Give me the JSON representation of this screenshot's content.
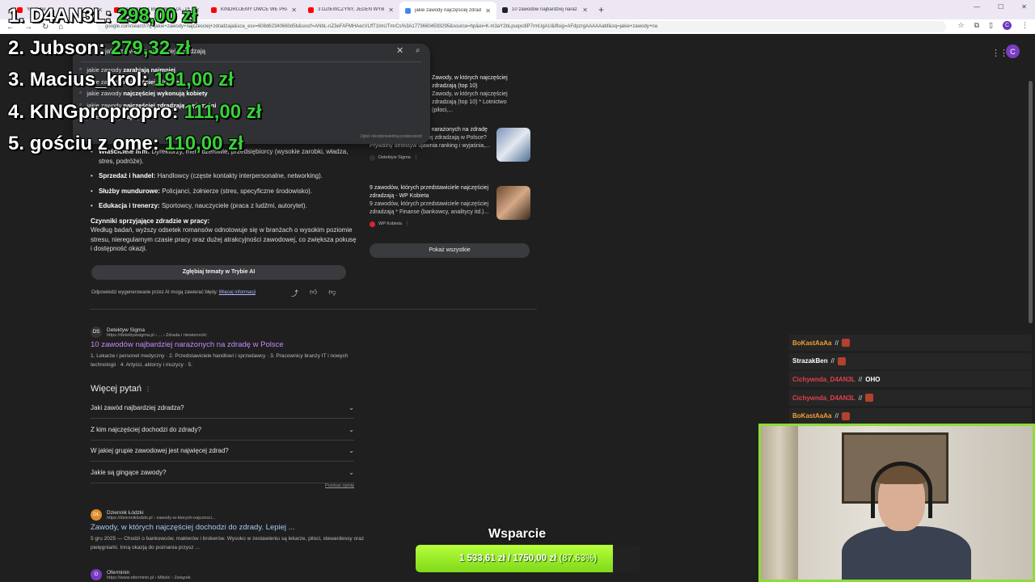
{
  "browser": {
    "tabs": [
      {
        "title": "YouTube",
        "color": "#ff0000"
      },
      {
        "title": "SPOWIEDŹ BRAMKARZA - PEJ",
        "color": "#ff0000"
      },
      {
        "title": "KINDRUJEMY OWCE WE PRAW",
        "color": "#ff0000"
      },
      {
        "title": "3 DZIEWCZYNY, JEDEN WYBÓ",
        "color": "#ff0000"
      },
      {
        "title": "jakie zawody najczęściej zdradz",
        "color": "#4285f4",
        "active": true
      },
      {
        "title": "10 zawodów najbardziej naraż",
        "color": "#202124"
      }
    ],
    "url": "google.com/search?q=jakie+zawody+najczesciej+zdradzaja&sca_esv=608d62340660d5b&sxsrf=ANbL-nZ3eFAFMHAecVLffT1lmUTmrCs%3A17736604593295&source=hp&ei=K-m3aY2bLpuqxc8P7rmUgAU&iflsig=AFdpzrgAAAAAabf&oq=jakie+zawody+na",
    "avatar_letter": "C"
  },
  "search": {
    "query": "jakie zawody najczęściej zdradzają",
    "suggestions": [
      {
        "prefix": "jakie zawody ",
        "bold": "zarabiają najmniej"
      },
      {
        "prefix": "jakie zawody ",
        "bold": "najczęściej zdradzają"
      },
      {
        "prefix": "jakie zawody ",
        "bold": "najczęściej wykonują kobiety"
      },
      {
        "prefix": "jakie zawody ",
        "bold": "najczęściej zdradzają mężczyźni"
      },
      {
        "prefix": "jakie zawody ",
        "bold": "najlepsze"
      }
    ],
    "report": "Zgłoś nieodpowiednią podpowiedź"
  },
  "ai_overview": {
    "items": [
      {
        "bold": "Właściciele firm:",
        "text": " Dyrektorzy, menedżerowie, przedsiębiorcy (wysokie zarobki, władza, stres, podróże)."
      },
      {
        "bold": "Sprzedaż i handel:",
        "text": " Handlowcy (częste kontakty interpersonalne, networking)."
      },
      {
        "bold": "Służby mundurowe:",
        "text": " Policjanci, żołnierze (stres, specyficzne środowisko)."
      },
      {
        "bold": "Edukacja i trenerzy:",
        "text": " Sportowcy, nauczyciele (praca z ludźmi, autorytet)."
      }
    ],
    "factors_heading": "Czynniki sprzyjające zdradzie w pracy:",
    "factors_text": "Według badań, wyższy odsetek romansów odnotowuje się w branżach o wysokim poziomie stresu, nieregularnym czasie pracy oraz dużej atrakcyjności zawodowej, co zwiększa pokusę i dostępność okazji.",
    "dive_button": "Zgłębiaj tematy w Trybie AI",
    "disclaimer": "Odpowiedzi wygenerowane przez AI mogą zawierać błędy. ",
    "more_info": "Więcej informacji"
  },
  "sources": [
    {
      "title": "Zawody, w których najczęściej zdradzają (top 10)",
      "snippet": "Zawody, w których najczęściej zdradzają (top 10) * Lotnictwo (piloci,...",
      "name": ""
    },
    {
      "title": "10 zawodów najbardziej narażonych na zdradę",
      "snippet": "Które zawody najczęściej zdradzają w Polsce? Prywatny detektyw ujawnia ranking i wyjaśnia,...",
      "name": "Detektyw Sigma"
    },
    {
      "title": "9 zawodów, których przedstawiciele najczęściej zdradzają - WP Kobieta",
      "snippet": "9 zawodów, których przedstawiciele najczęściej zdradzają * Finanse (bankowcy, analitycy itd.)...",
      "name": "WP Kobieta"
    }
  ],
  "show_all": "Pokaż wszystkie",
  "results": [
    {
      "site": "Detektyw Sigma",
      "url": "https://detektywsigma.pl › ... › Zdrada i niewierność",
      "title": "10 zawodów najbardziej narażonych na zdradę w Polsce",
      "snippet": "1. Lekarze i personel medyczny · 2. Przedstawiciele handlowi i sprzedawcy · 3. Pracownicy branży IT i nowych technologii · 4. Artyści, aktorzy i muzycy · 5.",
      "icon": "DS"
    },
    {
      "site": "Dziennik Łódzki",
      "url": "https://dzienniklodzki.pl › zawody-w-ktorych-najczesci...",
      "title": "Zawody, w których najczęściej dochodzi do zdrady. Lepiej ...",
      "snippet": "5 gru 2025 — Chodzi o bankowców, maklerów i brokerów. Wysoko w zestawieniu są lekarze, piloci, stewardessy oraz pielęgniarki. Inną okazją do poznania przysz ...",
      "icon": "DŁ"
    },
    {
      "site": "Oferminin",
      "url": "https://www.oferminin.pl › Miłość › Związek",
      "icon": "O"
    }
  ],
  "paa": {
    "title": "Więcej pytań",
    "questions": [
      "Jaki zawód najbardziej zdradza?",
      "Z kim najczęściej dochodzi do zdrady?",
      "W jakiej grupie zawodowej jest najwięcej zdrad?",
      "Jakie są gingące zawody?"
    ],
    "feedback": "Przekaż opinię"
  },
  "leaderboard": [
    {
      "rank": "1.",
      "name": "D4AN3L:",
      "amount": "298,00 zł"
    },
    {
      "rank": "2.",
      "name": "Jubson:",
      "amount": "279,32 zł"
    },
    {
      "rank": "3.",
      "name": "Macius_krol:",
      "amount": "191,00 zł"
    },
    {
      "rank": "4.",
      "name": "KINGpropropro:",
      "amount": "111,00 zł"
    },
    {
      "rank": "5.",
      "name": "gościu z ome:",
      "amount": "110,00 zł"
    }
  ],
  "chat": [
    {
      "user": "BoKastAaAa",
      "color": "#f0a030",
      "msg": ""
    },
    {
      "user": "StrazakBen",
      "color": "#ffffff",
      "msg": ""
    },
    {
      "user": "Cichywnda_D4AN3L",
      "color": "#e0404a",
      "msg": "OHO"
    },
    {
      "user": "Cichywnda_D4AN3L",
      "color": "#e0404a",
      "msg": ""
    },
    {
      "user": "BoKastAaAa",
      "color": "#f0a030",
      "msg": ""
    }
  ],
  "donation": {
    "title": "Wsparcie",
    "current": "1 533,61 zł",
    "separator": "/",
    "goal": "1750,00 zł",
    "percent_label": "(87.63%)",
    "fraction": 0.8763
  }
}
